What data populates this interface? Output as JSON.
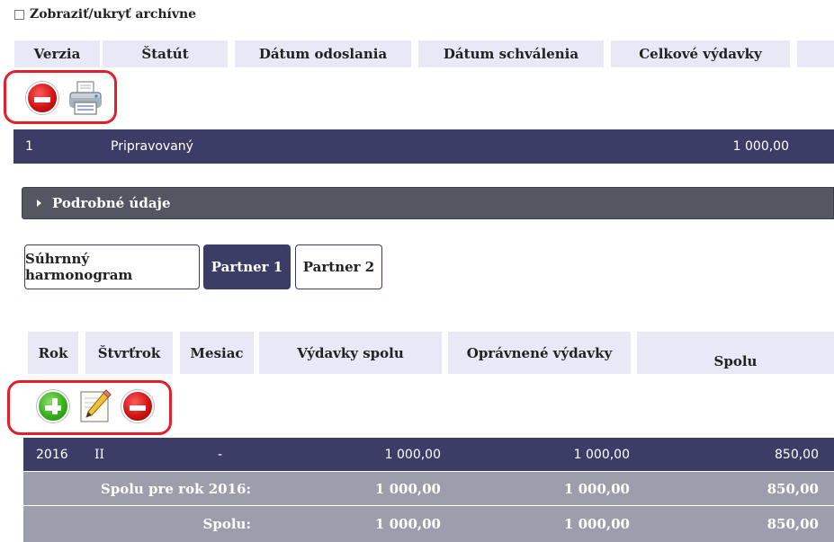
{
  "archive_toggle": {
    "label": "Zobraziť/ukryť archívne",
    "checked": false
  },
  "versions_table": {
    "headers": [
      "Verzia",
      "Štatút",
      "Dátum odoslania",
      "Dátum schválenia",
      "Celkové výdavky"
    ],
    "actions": [
      "remove-icon",
      "print-icon"
    ],
    "rows": [
      {
        "verzia": "1",
        "statut": "Pripravovaný",
        "datum_odoslania": "",
        "datum_schvalenia": "",
        "celkove_vydavky": "1 000,00"
      }
    ]
  },
  "details_section": {
    "label": "Podrobné údaje"
  },
  "tabs": [
    {
      "label": "Súhrnný harmonogram",
      "active": false
    },
    {
      "label": "Partner 1",
      "active": true
    },
    {
      "label": "Partner 2",
      "active": false
    }
  ],
  "schedule_table": {
    "headers": [
      "Rok",
      "Štvrťrok",
      "Mesiac",
      "Výdavky spolu",
      "Oprávnené výdavky",
      "Spolu"
    ],
    "actions": [
      "add-icon",
      "edit-icon",
      "remove-icon"
    ],
    "rows": [
      {
        "rok": "2016",
        "stvrtrok": "II",
        "mesiac": "-",
        "vydavky_spolu": "1 000,00",
        "opravnene_vydavky": "1 000,00",
        "spolu": "850,00"
      }
    ],
    "year_total": {
      "label": "Spolu pre rok 2016:",
      "vydavky_spolu": "1 000,00",
      "opravnene_vydavky": "1 000,00",
      "spolu": "850,00"
    },
    "grand_total": {
      "label": "Spolu:",
      "vydavky_spolu": "1 000,00",
      "opravnene_vydavky": "1 000,00",
      "spolu": "850,00"
    }
  },
  "colors": {
    "header_bg": "#e8e8f6",
    "row_dark": "#3c3d66",
    "summary_bg": "#9d9eab",
    "details_bg": "#545661",
    "annotation": "#e3202a"
  }
}
